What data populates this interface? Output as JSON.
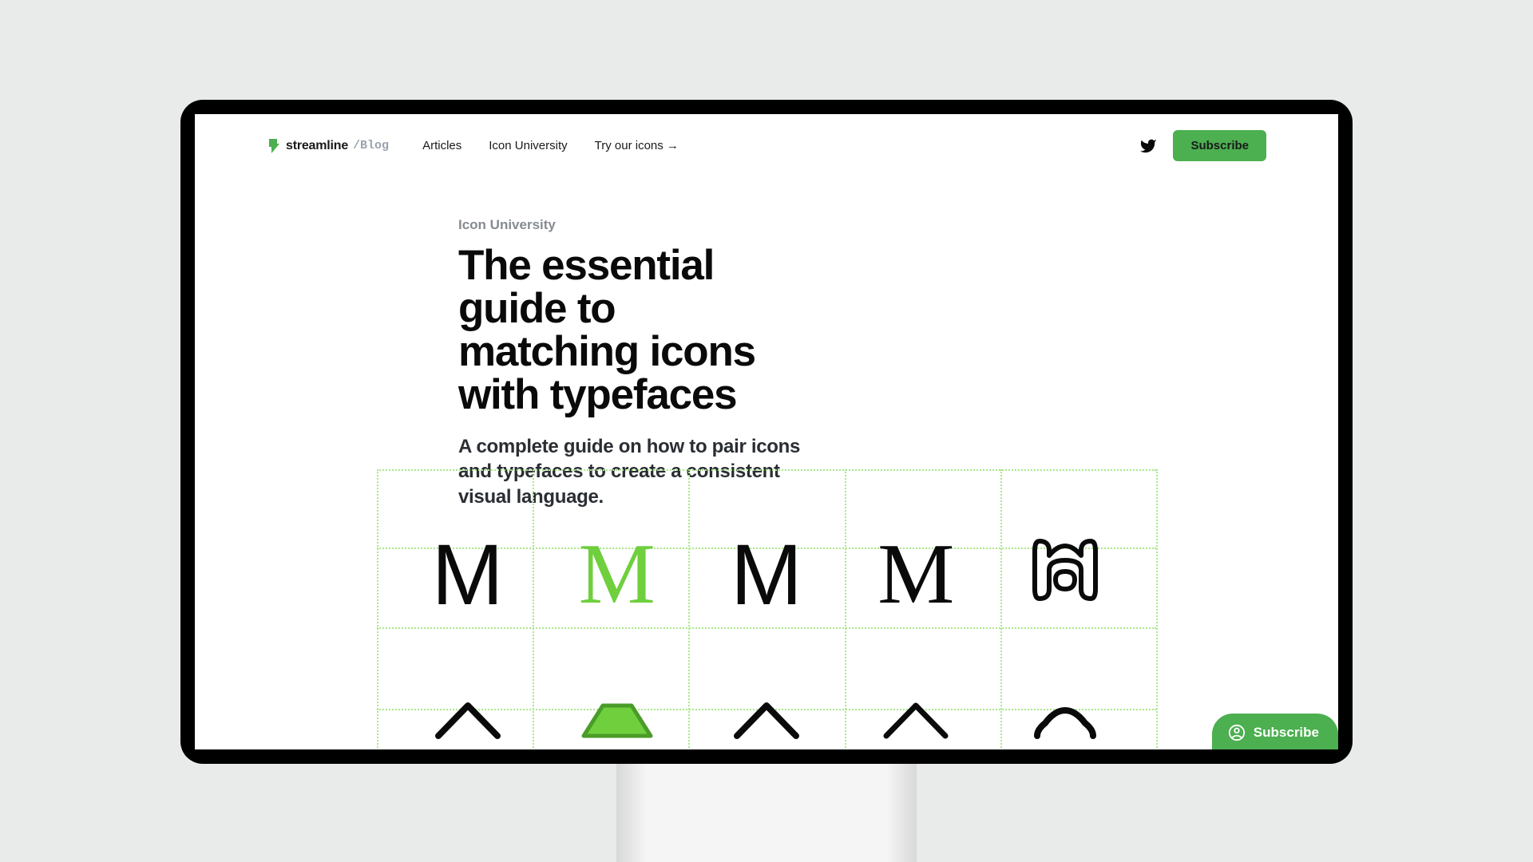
{
  "brand": {
    "name": "streamline",
    "blog_suffix": "/Blog"
  },
  "nav": {
    "articles": "Articles",
    "icon_university": "Icon University",
    "try_icons": "Try our icons →"
  },
  "header": {
    "subscribe": "Subscribe"
  },
  "article": {
    "category": "Icon University",
    "title": "The essential guide to matching icons with typefaces",
    "subtitle": "A complete guide on how to pair icons and typefaces to create a consistent visual language."
  },
  "pill": {
    "subscribe": "Subscribe"
  },
  "glyphs": {
    "m1": "M",
    "m2": "M",
    "m3": "M",
    "m4": "M"
  },
  "colors": {
    "accent": "#4caf50",
    "grid": "#a9e88a",
    "highlight": "#6fcf3d"
  }
}
